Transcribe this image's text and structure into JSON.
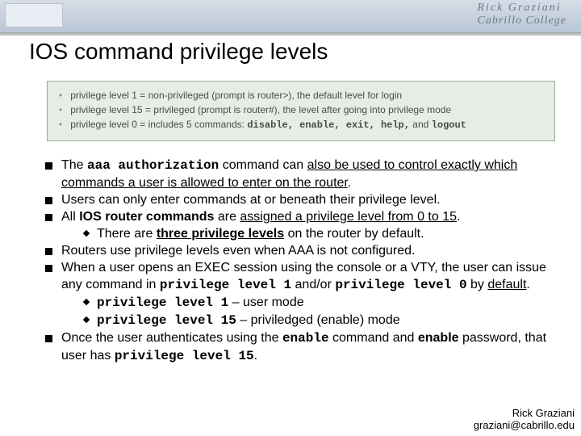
{
  "header": {
    "brand_line1": "Rick Graziani",
    "brand_line2": "Cabrillo College"
  },
  "title": "IOS command privilege levels",
  "panel": {
    "line1_pre": "privilege level 1 = non-privileged (prompt is router>), the default level for login",
    "line2_pre": "privilege level 15 = privileged (prompt is router#), the level after going into privilege mode",
    "line3_pre": "privilege level 0 = includes 5 commands: ",
    "line3_cmds": "disable, enable, exit, help,",
    "line3_and": " and ",
    "line3_last": "logout"
  },
  "bullets": {
    "b1_pre": "The ",
    "b1_code": "aaa authorization",
    "b1_mid": " command can ",
    "b1_u": "also be used to control exactly which commands a user is allowed to enter on the router",
    "b1_post": ".",
    "b2": "Users can only enter commands at or beneath their privilege level.",
    "b3_pre": "All ",
    "b3_bold": "IOS router commands",
    "b3_mid": " are ",
    "b3_u": "assigned a privilege level from 0 to 15",
    "b3_post": ".",
    "b3s_pre": "There are ",
    "b3s_u": "three privilege levels",
    "b3s_post": " on the router by default.",
    "b4": "Routers use privilege levels even when AAA is not configured.",
    "b5_pre": "When a user opens an EXEC session using the console or a VTY, the user can issue any command in ",
    "b5_c1": "privilege level 1",
    "b5_mid": " and/or ",
    "b5_c2": "privilege level 0",
    "b5_post": " by ",
    "b5_u": "default",
    "b5_end": ".",
    "b5s1_code": "privilege level 1",
    "b5s1_text": " – user mode",
    "b5s2_code": "privilege level 15",
    "b5s2_text": " – priviledged (enable) mode",
    "b6_pre": "Once the user authenticates using the ",
    "b6_c1": "enable",
    "b6_mid1": " command and ",
    "b6_bold": "enable",
    "b6_mid2": " password, that user has ",
    "b6_c2": "privilege level 15",
    "b6_post": "."
  },
  "footer": {
    "name": "Rick Graziani",
    "email": "graziani@cabrillo.edu"
  }
}
